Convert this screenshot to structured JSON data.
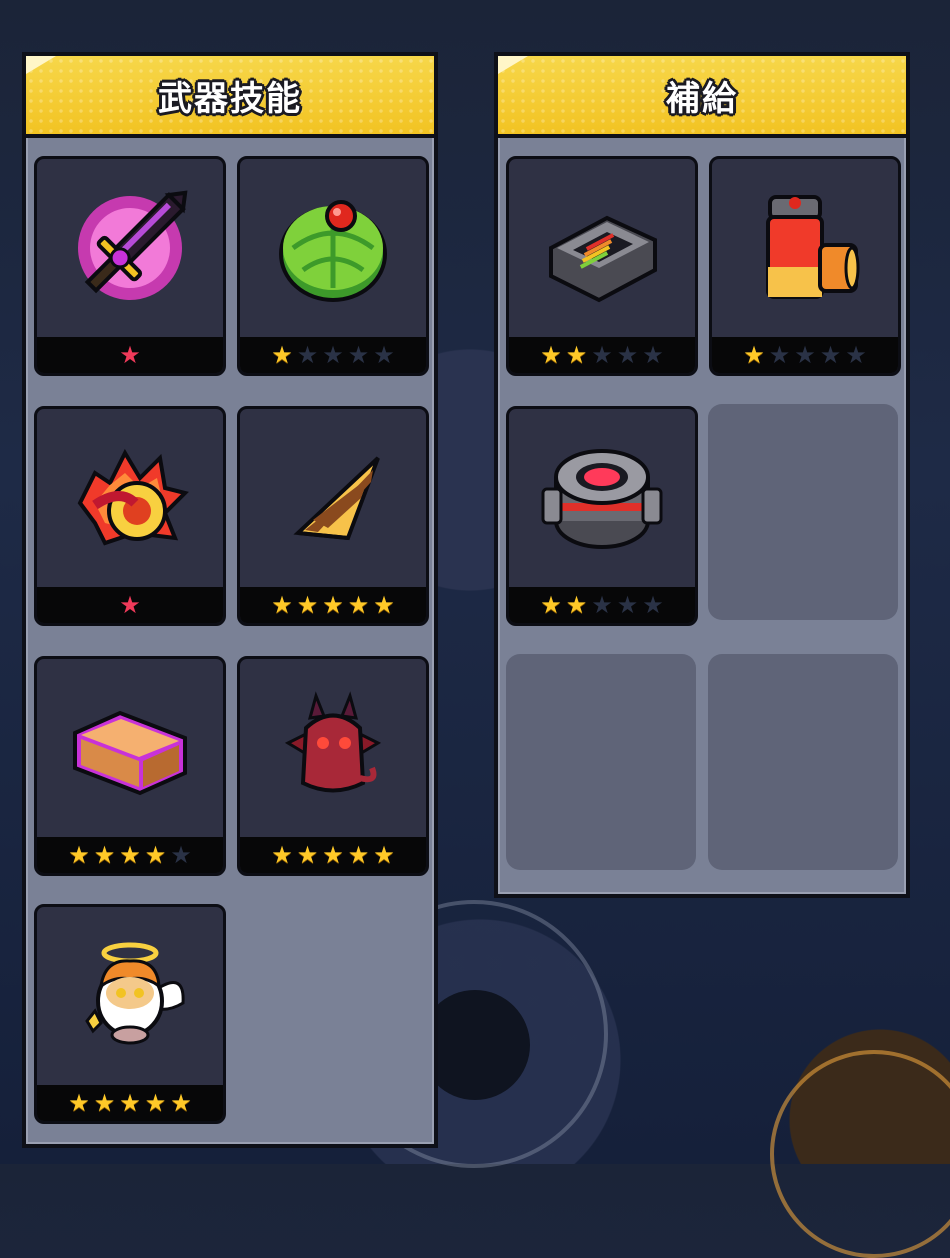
{
  "weapons": {
    "title": "武器技能",
    "items": [
      {
        "name": "magic-sword",
        "stars": [
          {
            "s": "★",
            "c": "red"
          }
        ]
      },
      {
        "name": "green-disc",
        "stars": [
          {
            "s": "★",
            "c": "on"
          },
          {
            "s": "★",
            "c": "off"
          },
          {
            "s": "★",
            "c": "off"
          },
          {
            "s": "★",
            "c": "off"
          },
          {
            "s": "★",
            "c": "off"
          }
        ]
      },
      {
        "name": "fire-ring",
        "stars": [
          {
            "s": "★",
            "c": "red"
          }
        ]
      },
      {
        "name": "drill-cone",
        "stars": [
          {
            "s": "★",
            "c": "on"
          },
          {
            "s": "★",
            "c": "on"
          },
          {
            "s": "★",
            "c": "on"
          },
          {
            "s": "★",
            "c": "on"
          },
          {
            "s": "★",
            "c": "on"
          }
        ]
      },
      {
        "name": "brick",
        "stars": [
          {
            "s": "★",
            "c": "on"
          },
          {
            "s": "★",
            "c": "on"
          },
          {
            "s": "★",
            "c": "on"
          },
          {
            "s": "★",
            "c": "on"
          },
          {
            "s": "★",
            "c": "off"
          }
        ]
      },
      {
        "name": "devil-pet",
        "stars": [
          {
            "s": "★",
            "c": "on"
          },
          {
            "s": "★",
            "c": "on"
          },
          {
            "s": "★",
            "c": "on"
          },
          {
            "s": "★",
            "c": "on"
          },
          {
            "s": "★",
            "c": "on"
          }
        ]
      },
      {
        "name": "angel-pet",
        "stars": [
          {
            "s": "★",
            "c": "on"
          },
          {
            "s": "★",
            "c": "on"
          },
          {
            "s": "★",
            "c": "on"
          },
          {
            "s": "★",
            "c": "on"
          },
          {
            "s": "★",
            "c": "on"
          }
        ]
      }
    ]
  },
  "supplies": {
    "title": "補給",
    "items": [
      {
        "name": "battery-pack",
        "stars": [
          {
            "s": "★",
            "c": "on"
          },
          {
            "s": "★",
            "c": "on"
          },
          {
            "s": "★",
            "c": "off"
          },
          {
            "s": "★",
            "c": "off"
          },
          {
            "s": "★",
            "c": "off"
          }
        ]
      },
      {
        "name": "fuel-canister",
        "stars": [
          {
            "s": "★",
            "c": "on"
          },
          {
            "s": "★",
            "c": "off"
          },
          {
            "s": "★",
            "c": "off"
          },
          {
            "s": "★",
            "c": "off"
          },
          {
            "s": "★",
            "c": "off"
          }
        ]
      },
      {
        "name": "energy-core",
        "stars": [
          {
            "s": "★",
            "c": "on"
          },
          {
            "s": "★",
            "c": "on"
          },
          {
            "s": "★",
            "c": "off"
          },
          {
            "s": "★",
            "c": "off"
          },
          {
            "s": "★",
            "c": "off"
          }
        ]
      }
    ]
  }
}
